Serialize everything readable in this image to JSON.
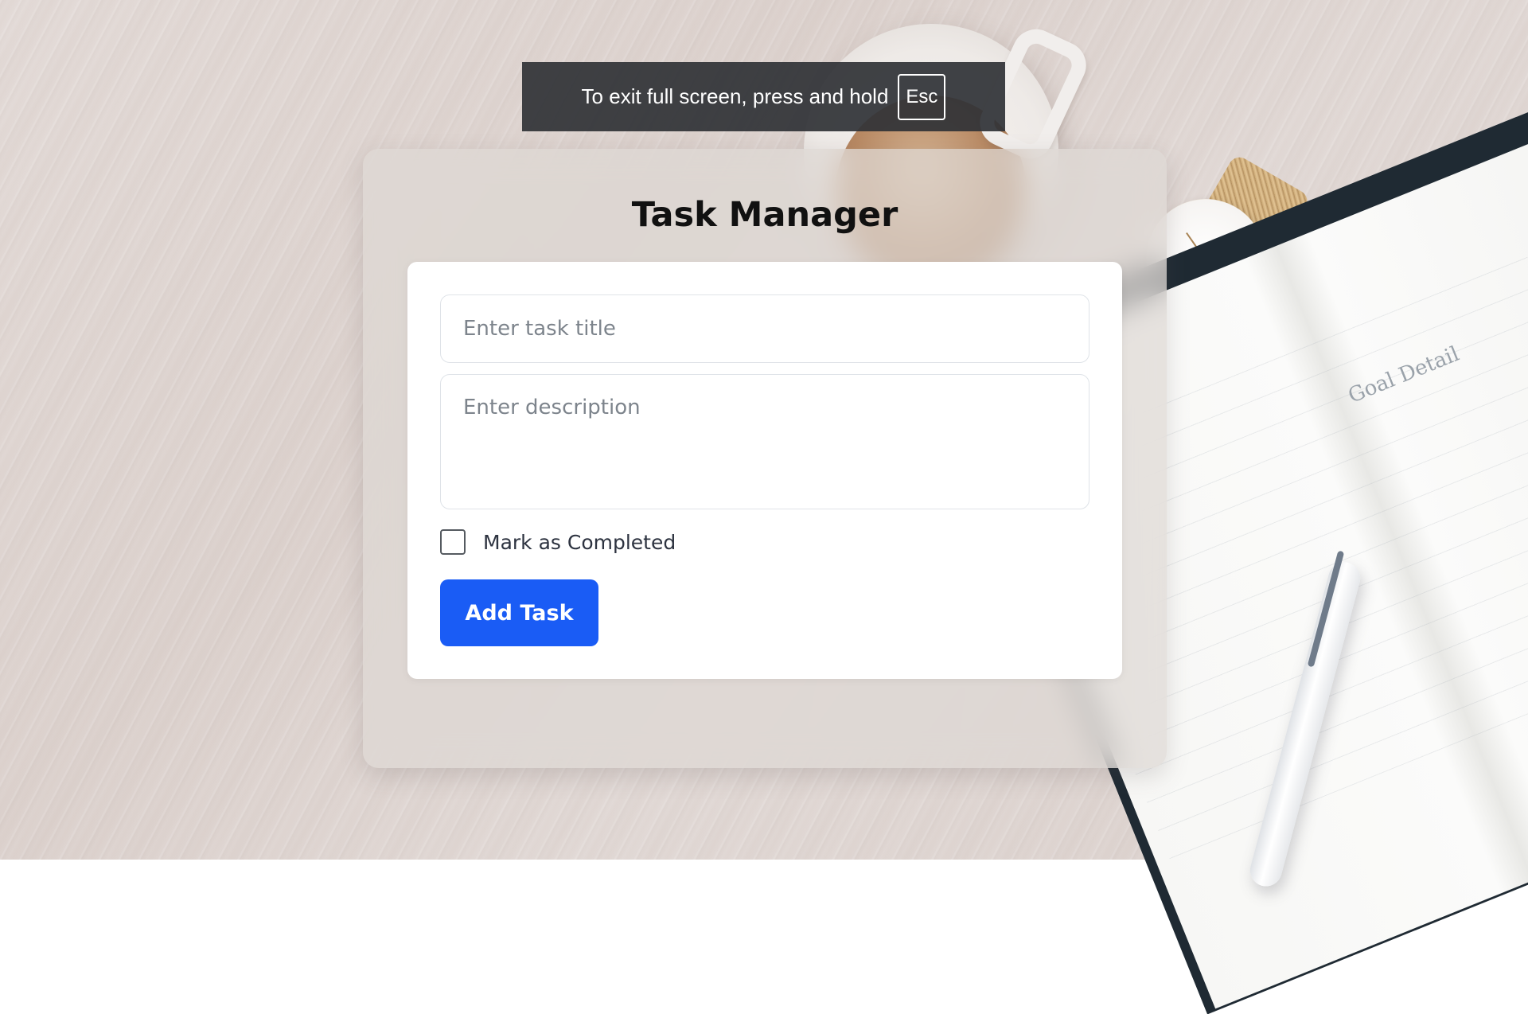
{
  "fullscreen_notice": {
    "message": "To exit full screen, press and hold",
    "key": "Esc"
  },
  "background": {
    "notebook_heading": "Goal Detail"
  },
  "app": {
    "title": "Task Manager"
  },
  "form": {
    "title_placeholder": "Enter task title",
    "title_value": "",
    "description_placeholder": "Enter description",
    "description_value": "",
    "completed_label": "Mark as Completed",
    "completed_checked": false,
    "add_button_label": "Add Task"
  },
  "colors": {
    "accent": "#1a5cf5",
    "toast_background": "#303236"
  }
}
